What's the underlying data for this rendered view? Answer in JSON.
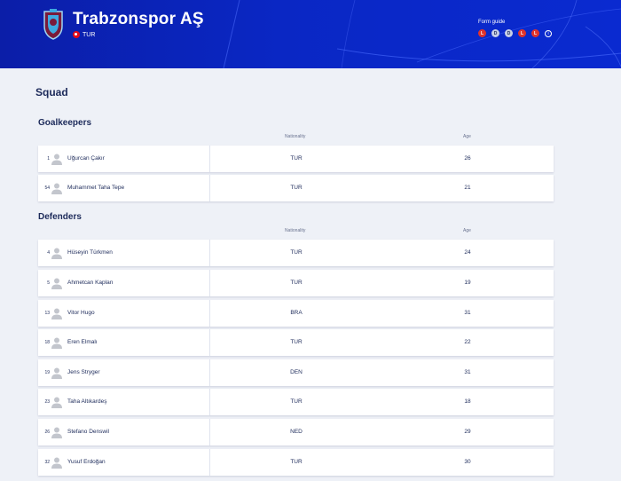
{
  "header": {
    "team_name": "Trabzonspor AŞ",
    "country": "TUR",
    "form_title": "Form guide",
    "form": [
      "L",
      "D",
      "D",
      "L",
      "L"
    ],
    "info_glyph": "i",
    "colors": {
      "loss": "#e0332c",
      "draw": "#c7cfe6",
      "brand": "#0a27c4"
    }
  },
  "squad_title": "Squad",
  "columns": {
    "nationality": "Nationality",
    "age": "Age"
  },
  "sections": [
    {
      "title": "Goalkeepers",
      "players": [
        {
          "number": "1",
          "name": "Uğurcan Çakır",
          "nationality": "TUR",
          "age": "26"
        },
        {
          "number": "54",
          "name": "Muhammet Taha Tepe",
          "nationality": "TUR",
          "age": "21"
        }
      ]
    },
    {
      "title": "Defenders",
      "players": [
        {
          "number": "4",
          "name": "Hüseyin Türkmen",
          "nationality": "TUR",
          "age": "24"
        },
        {
          "number": "5",
          "name": "Ahmetcan Kaplan",
          "nationality": "TUR",
          "age": "19"
        },
        {
          "number": "13",
          "name": "Vitor Hugo",
          "nationality": "BRA",
          "age": "31"
        },
        {
          "number": "18",
          "name": "Eren Elmalı",
          "nationality": "TUR",
          "age": "22"
        },
        {
          "number": "19",
          "name": "Jens Stryger",
          "nationality": "DEN",
          "age": "31"
        },
        {
          "number": "23",
          "name": "Taha Altıkardeş",
          "nationality": "TUR",
          "age": "18"
        },
        {
          "number": "26",
          "name": "Stefano Denswil",
          "nationality": "NED",
          "age": "29"
        },
        {
          "number": "32",
          "name": "Yusuf Erdoğan",
          "nationality": "TUR",
          "age": "30"
        }
      ]
    }
  ]
}
